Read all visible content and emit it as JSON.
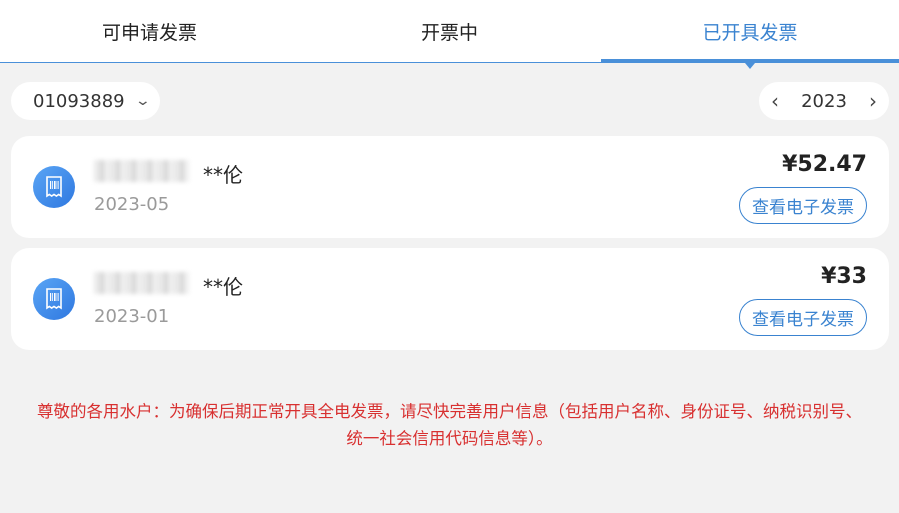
{
  "tabs": [
    {
      "label": "可申请发票",
      "active": false
    },
    {
      "label": "开票中",
      "active": false
    },
    {
      "label": "已开具发票",
      "active": true
    }
  ],
  "filters": {
    "account_number": "01093889",
    "year": "2023"
  },
  "invoices": [
    {
      "name": "**伦",
      "date": "2023-05",
      "amount": "¥52.47",
      "action_label": "查看电子发票"
    },
    {
      "name": "**伦",
      "date": "2023-01",
      "amount": "¥33",
      "action_label": "查看电子发票"
    }
  ],
  "notice": {
    "line1": "尊敬的各用水户：为确保后期正常开具全电发票，请尽快完善用户信息（包括用户名称、身份证号、纳税识别号、",
    "line2": "统一社会信用代码信息等）。"
  },
  "icons": {
    "invoice": "receipt-icon",
    "dropdown": "chevron-down-icon",
    "prev": "chevron-left-icon",
    "next": "chevron-right-icon"
  },
  "colors": {
    "accent": "#3a83d0",
    "notice": "#d83030",
    "background": "#f2f2f2"
  }
}
